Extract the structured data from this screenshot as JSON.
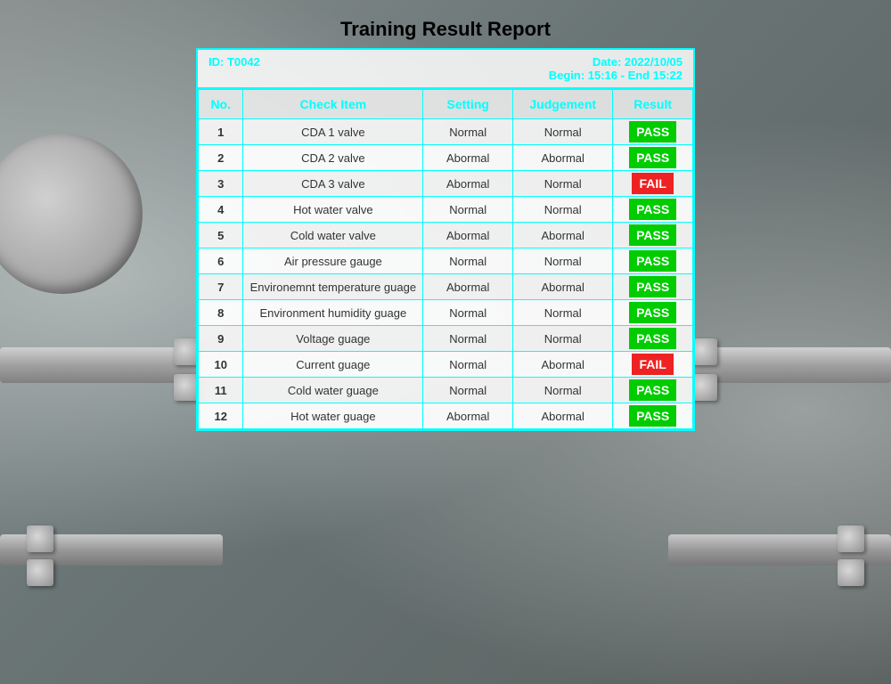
{
  "title": "Training Result Report",
  "header": {
    "id_label": "ID: T0042",
    "date_label": "Date: 2022/10/05",
    "time_label": "Begin: 15:16 - End 15:22"
  },
  "table": {
    "columns": [
      "No.",
      "Check Item",
      "Setting",
      "Judgement",
      "Result"
    ],
    "rows": [
      {
        "no": "1",
        "item": "CDA 1 valve",
        "setting": "Normal",
        "judgement": "Normal",
        "result": "PASS",
        "pass": true
      },
      {
        "no": "2",
        "item": "CDA 2 valve",
        "setting": "Abormal",
        "judgement": "Abormal",
        "result": "PASS",
        "pass": true
      },
      {
        "no": "3",
        "item": "CDA 3 valve",
        "setting": "Abormal",
        "judgement": "Normal",
        "result": "FAIL",
        "pass": false
      },
      {
        "no": "4",
        "item": "Hot water valve",
        "setting": "Normal",
        "judgement": "Normal",
        "result": "PASS",
        "pass": true
      },
      {
        "no": "5",
        "item": "Cold water valve",
        "setting": "Abormal",
        "judgement": "Abormal",
        "result": "PASS",
        "pass": true
      },
      {
        "no": "6",
        "item": "Air pressure gauge",
        "setting": "Normal",
        "judgement": "Normal",
        "result": "PASS",
        "pass": true
      },
      {
        "no": "7",
        "item": "Environemnt temperature guage",
        "setting": "Abormal",
        "judgement": "Abormal",
        "result": "PASS",
        "pass": true
      },
      {
        "no": "8",
        "item": "Environment humidity guage",
        "setting": "Normal",
        "judgement": "Normal",
        "result": "PASS",
        "pass": true
      },
      {
        "no": "9",
        "item": "Voltage guage",
        "setting": "Normal",
        "judgement": "Normal",
        "result": "PASS",
        "pass": true
      },
      {
        "no": "10",
        "item": "Current guage",
        "setting": "Normal",
        "judgement": "Abormal",
        "result": "FAIL",
        "pass": false
      },
      {
        "no": "11",
        "item": "Cold water guage",
        "setting": "Normal",
        "judgement": "Normal",
        "result": "PASS",
        "pass": true
      },
      {
        "no": "12",
        "item": "Hot water guage",
        "setting": "Abormal",
        "judgement": "Abormal",
        "result": "PASS",
        "pass": true
      }
    ]
  }
}
